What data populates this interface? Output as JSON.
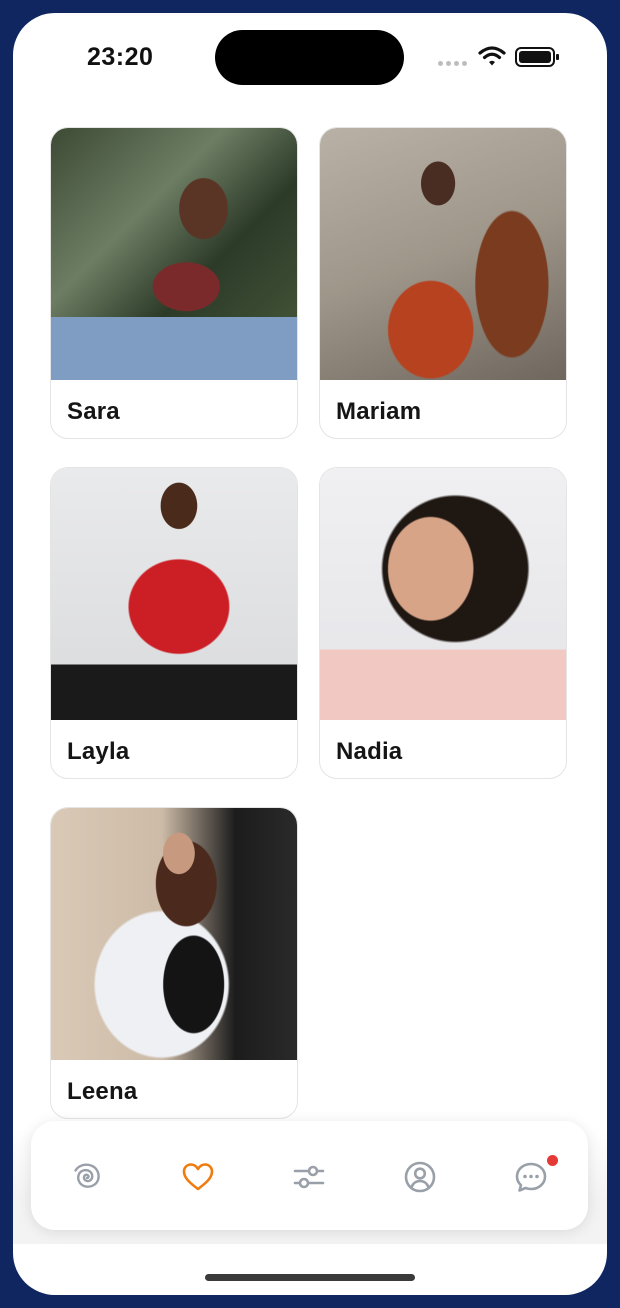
{
  "status_bar": {
    "time": "23:20"
  },
  "profiles": [
    {
      "name": "Sara"
    },
    {
      "name": "Mariam"
    },
    {
      "name": "Layla"
    },
    {
      "name": "Nadia"
    },
    {
      "name": "Leena"
    }
  ],
  "nav": {
    "items": [
      {
        "icon": "spiral-icon",
        "active": false
      },
      {
        "icon": "heart-icon",
        "active": true
      },
      {
        "icon": "sliders-icon",
        "active": false
      },
      {
        "icon": "profile-icon",
        "active": false
      },
      {
        "icon": "chat-icon",
        "active": false,
        "has_notification": true
      }
    ],
    "colors": {
      "active": "#f07c10",
      "inactive": "#9aa0aa",
      "notification": "#e53935"
    }
  },
  "colors": {
    "frame": "#0f2660",
    "background": "#ffffff"
  }
}
